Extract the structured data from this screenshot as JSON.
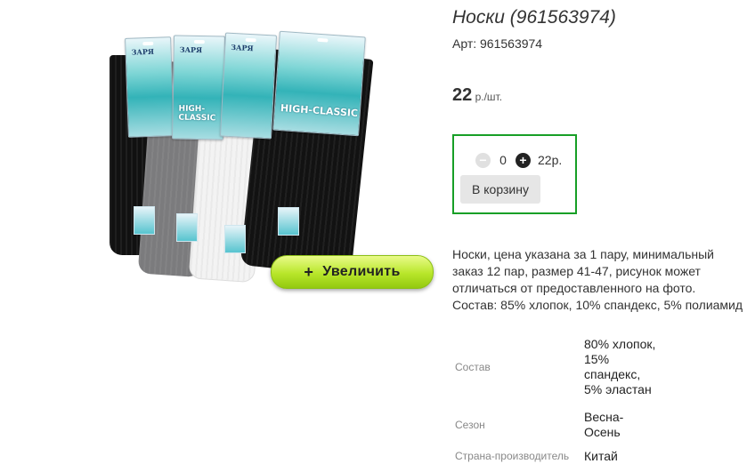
{
  "product": {
    "title": "Носки (961563974)",
    "sku": "Арт: 961563974",
    "price_value": "22",
    "price_unit": " р./шт.",
    "image_zoom_label": "Увеличить",
    "image_zoom_icon": "plus-icon",
    "packaging_brand": "ЗАРЯ",
    "packaging_line": "HIGH-CLASSIC"
  },
  "cart": {
    "quantity": "0",
    "row_total": "22р.",
    "minus_icon": "minus-circle-icon",
    "plus_icon": "plus-circle-icon",
    "add_to_cart_label": "В корзину",
    "border_color": "#179f26"
  },
  "description": {
    "lines": [
      "Носки, цена указана за 1 пару, минимальный",
      "заказ 12 пар, размер 41-47, рисунок может",
      "отличаться от предоставленного на фото.",
      "Состав: 85% хлопок, 10% спандекс, 5% полиамид"
    ]
  },
  "specs": [
    {
      "label": "Состав",
      "value": "80% хлопок, 15% спандекс, 5% эластан"
    },
    {
      "label": "Сезон",
      "value": "Весна-Осень"
    },
    {
      "label": "Страна-производитель",
      "value": "Китай"
    }
  ],
  "colors": {
    "zoom_button": "#b8e62a",
    "border_green": "#179f26"
  }
}
